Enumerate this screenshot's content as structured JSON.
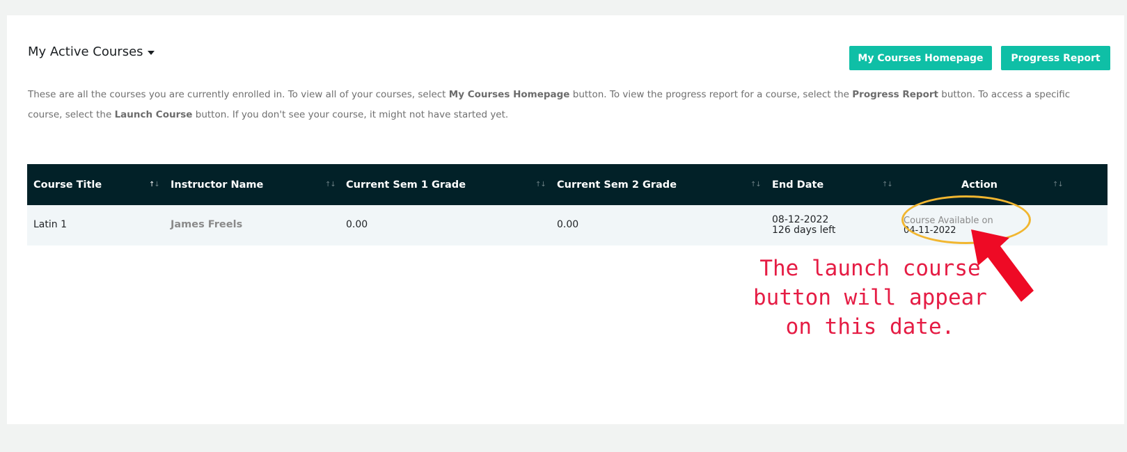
{
  "header": {
    "title": "My Active Courses",
    "home_button": "My Courses Homepage",
    "report_button": "Progress Report"
  },
  "description": {
    "p1": "These are all the courses you are currently enrolled in. To view all of your courses, select ",
    "b1": "My Courses Homepage",
    "p2": " button. To view the progress report for a course, select the ",
    "b2": "Progress Report",
    "p3": " button. To access a specific course, select the ",
    "b3": "Launch Course",
    "p4": " button. If you don't see your course, it might not have started yet."
  },
  "table": {
    "columns": [
      "Course Title",
      "Instructor Name",
      "Current Sem 1 Grade",
      "Current Sem 2 Grade",
      "End Date",
      "Action"
    ],
    "rows": [
      {
        "course_title": "Latin 1",
        "instructor": "James Freels",
        "sem1_grade": "0.00",
        "sem2_grade": "0.00",
        "end_date": "08-12-2022",
        "days_left": "126 days left",
        "action_label": "Course Available on",
        "action_date": "04-11-2022"
      }
    ]
  },
  "annotation": {
    "line1": "The launch course",
    "line2": "button will appear",
    "line3": "on this date.",
    "color": "#e51c44",
    "highlight_color": "#f1b630"
  },
  "colors": {
    "accent": "#0fbfa6",
    "table_header": "#022128",
    "row_bg": "#f1f6f8"
  }
}
